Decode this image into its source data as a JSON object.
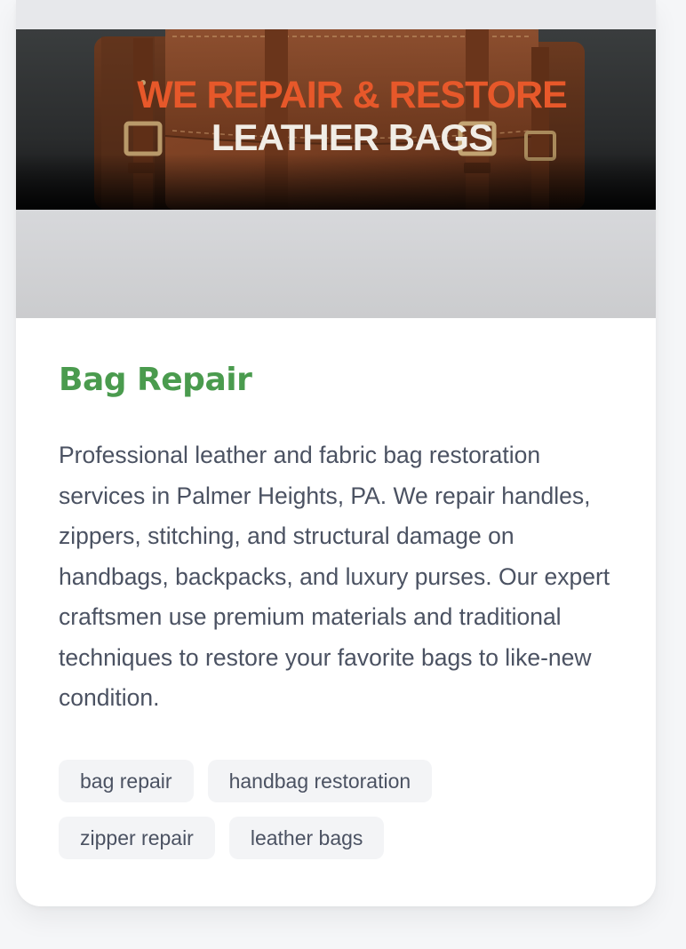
{
  "card": {
    "image": {
      "headline_line1": "WE REPAIR & RESTORE",
      "headline_line2": "LEATHER BAGS"
    },
    "title": "Bag Repair",
    "description": "Professional leather and fabric bag restoration services in Palmer Heights, PA. We repair handles, zippers, stitching, and structural damage on handbags, backpacks, and luxury purses. Our expert craftsmen use premium materials and traditional techniques to restore your favorite bags to like-new condition.",
    "tags": [
      "bag repair",
      "handbag restoration",
      "zipper repair",
      "leather bags"
    ]
  },
  "colors": {
    "title": "#4a9b4e",
    "text": "#4b5262",
    "tag_bg": "#f3f4f6",
    "headline_orange": "#e7582a",
    "headline_white": "#f1ede6",
    "leather": "#7a3f22"
  }
}
